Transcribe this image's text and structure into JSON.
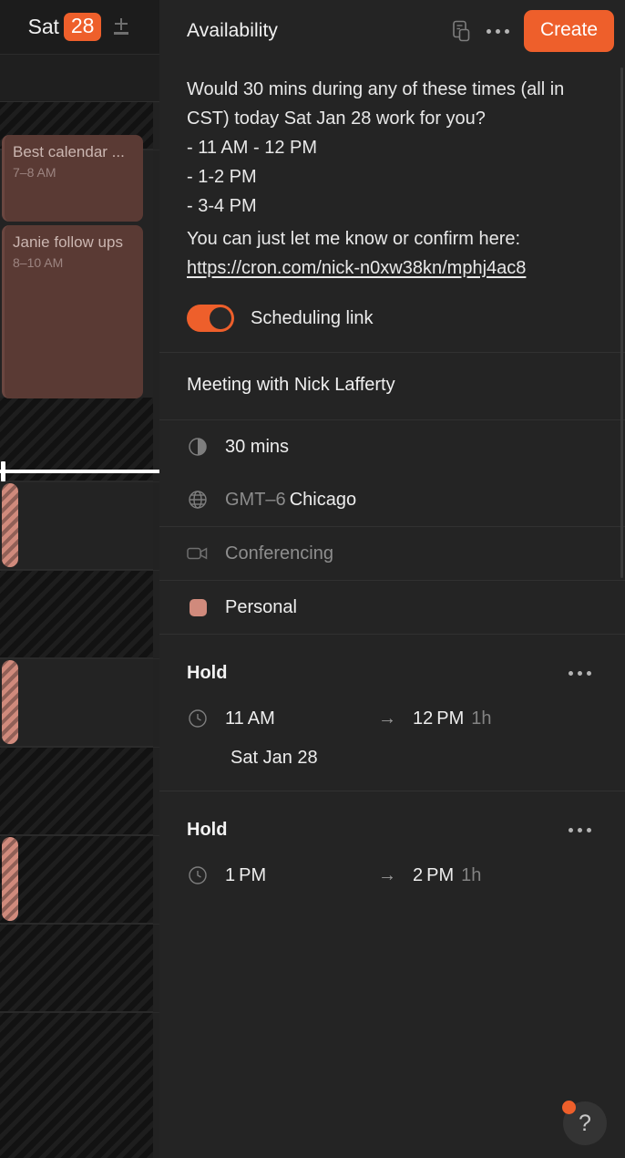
{
  "calendar": {
    "day_of_week": "Sat",
    "day_number": "28",
    "zoom_icon": "plus-underline-icon",
    "events": [
      {
        "title": "Best calendar ...",
        "time": "7–8 AM"
      },
      {
        "title": "Janie follow ups",
        "time": "8–10 AM"
      }
    ],
    "hold_blocks": [
      {
        "label": "hold-11am"
      },
      {
        "label": "hold-1pm"
      },
      {
        "label": "hold-3pm"
      }
    ],
    "now_indicator": "current-time-line"
  },
  "panel": {
    "title": "Availability",
    "duplicate_icon": "duplicate-document-icon",
    "more_icon": "more-options-icon",
    "create_label": "Create",
    "description": "Would 30 mins during any of these times (all in CST) today Sat Jan 28 work for you?\n- 11 AM - 12 PM\n- 1-2 PM\n- 3-4 PM",
    "link_intro": "You can just let me know or confirm here:",
    "link_url": "https://cron.com/nick-n0xw38kn/mphj4ac8",
    "toggle": {
      "label": "Scheduling link",
      "state": "on",
      "accent": "#ee5f2b"
    },
    "meeting_title": "Meeting with Nick Lafferty",
    "duration": {
      "icon": "half-circle-duration-icon",
      "value": "30 mins"
    },
    "timezone": {
      "icon": "globe-icon",
      "offset": "GMT–6",
      "city": "Chicago"
    },
    "conferencing": {
      "icon": "video-camera-icon",
      "label": "Conferencing"
    },
    "calendar_select": {
      "color": "#d08a7c",
      "label": "Personal"
    },
    "holds": [
      {
        "title": "Hold",
        "more_icon": "more-options-icon",
        "clock_icon": "clock-icon",
        "start": "11 AM",
        "arrow": "→",
        "end": "12 PM",
        "duration": "1h",
        "date": "Sat Jan 28"
      },
      {
        "title": "Hold",
        "more_icon": "more-options-icon",
        "clock_icon": "clock-icon",
        "start": "1 PM",
        "arrow": "→",
        "end": "2 PM",
        "duration": "1h",
        "date": ""
      }
    ],
    "help": {
      "icon": "question-mark-icon",
      "badge": "notification-dot"
    }
  }
}
